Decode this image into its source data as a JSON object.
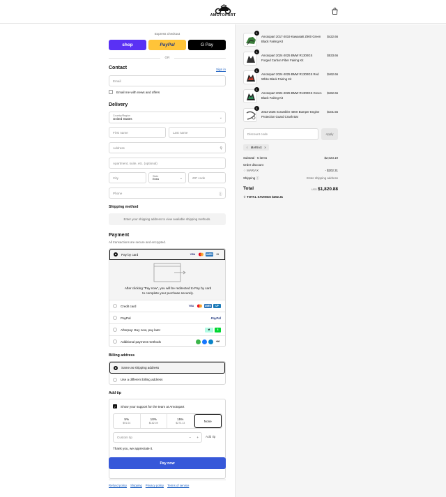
{
  "brand": {
    "name": "AMOTOPART"
  },
  "express": {
    "title": "Express checkout",
    "shop_label": "shop",
    "paypal_label": "PayPal",
    "gpay_label": "G Pay",
    "or_label": "OR"
  },
  "contact": {
    "heading": "Contact",
    "sign_in": "Sign in",
    "email_placeholder": "Email",
    "newsletter_label": "Email me with news and offers"
  },
  "delivery": {
    "heading": "Delivery",
    "country_label": "Country/Region",
    "country_value": "United States",
    "first_name": "First name",
    "last_name": "Last name",
    "address": "Address",
    "apartment": "Apartment, suite, etc. (optional)",
    "city": "City",
    "state_label": "State",
    "state_value": "Enea",
    "zip": "ZIP code",
    "phone": "Phone"
  },
  "shipping": {
    "heading": "Shipping method",
    "note": "Enter your shipping address to view available shipping methods."
  },
  "payment": {
    "heading": "Payment",
    "subtitle": "All transactions are secure and encrypted.",
    "pay_by_card": "Pay by card",
    "more_count": "+3",
    "redirect_text": "After clicking “Pay now”, you will be redirected to Pay by card to complete your purchase securely.",
    "credit_card": "Credit card",
    "paypal": "PayPal",
    "afterpay": "Afterpay: Buy now, pay later",
    "additional": "Additional payment methods",
    "additional_more": "+66",
    "logos": {
      "visa": "VISA",
      "mc": "MC",
      "amex": "AMEX",
      "union": "UP",
      "paypal_logo": "PayPal"
    }
  },
  "billing": {
    "heading": "Billing address",
    "same": "Same as shipping address",
    "different": "Use a different billing address"
  },
  "tip": {
    "heading": "Add tip",
    "support_label": "Show your support for the team at Amotopart",
    "options": [
      {
        "pct": "5%",
        "amt": "$91.04"
      },
      {
        "pct": "10%",
        "amt": "$182.09"
      },
      {
        "pct": "15%",
        "amt": "$273.13"
      },
      {
        "pct": "None",
        "amt": ""
      }
    ],
    "custom_placeholder": "Custom tip",
    "add_tip": "Add tip",
    "thanks": "Thank you, we appreciate it."
  },
  "pay_now": "Pay now",
  "footer": {
    "refund": "Refund policy",
    "shipping": "Shipping",
    "privacy": "Privacy policy",
    "terms": "Terms of service"
  },
  "cart_items": [
    {
      "name": "Amotopart 2017-2019 Kawasaki Z900 Green Black Fairing Kit",
      "price": "$422.66",
      "qty": "1",
      "color": "#3a7d3a"
    },
    {
      "name": "Amotopart 2024-2025 BMW R1300GS Forged Carbon Fiber Fairing Kit",
      "price": "$533.66",
      "qty": "1",
      "color": "#333333"
    },
    {
      "name": "Amotopart 2024-2025 BMW R1300GS Red White Black Fairing Kit",
      "price": "$462.66",
      "qty": "1",
      "color": "#c0392b"
    },
    {
      "name": "Amotopart 2024-2025 BMW R1300GS Green Black Fairing Kit",
      "price": "$462.66",
      "qty": "1",
      "color": "#2e8b57"
    },
    {
      "name": "2023-2025 Scrambler 400X Bumper Engine Protection Guard Crash Bar",
      "price": "$101.55",
      "qty": "1",
      "color": "#555555"
    }
  ],
  "discount": {
    "placeholder": "Discount code",
    "apply": "Apply",
    "code": "MARIAX"
  },
  "summary": {
    "subtotal_label": "Subtotal · 5 items",
    "subtotal": "$2,023.19",
    "order_discount": "Order discount",
    "discount_code": "MARIAX",
    "discount_value": "- $202.31",
    "shipping_label": "Shipping",
    "shipping_value": "Enter shipping address",
    "total_label": "Total",
    "currency": "USD",
    "total": "$1,820.88",
    "savings_label": "TOTAL SAVINGS",
    "savings": "$202.31"
  }
}
